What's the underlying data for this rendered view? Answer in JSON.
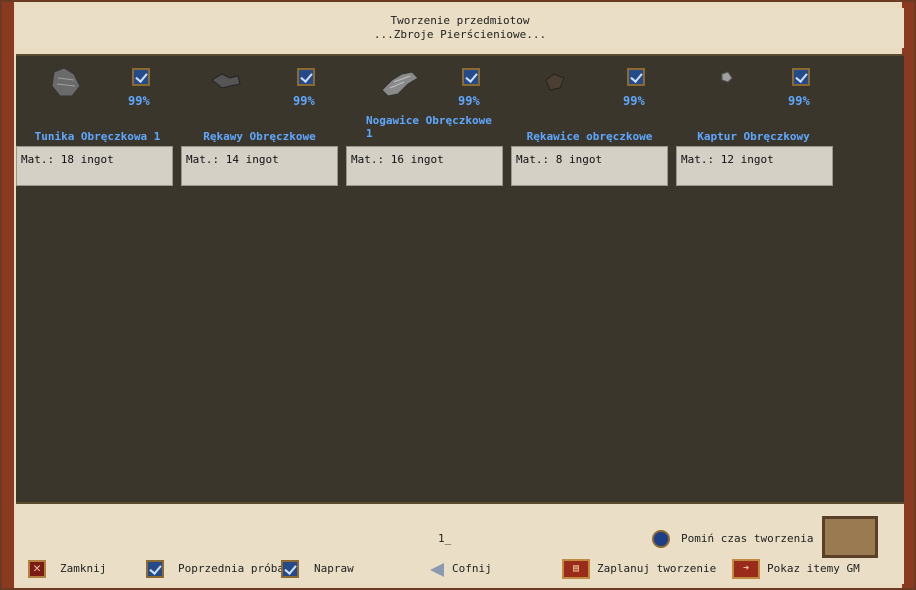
{
  "header": {
    "title": "Tworzenie przedmiotow",
    "subtitle": "...Zbroje Pierścieniowe..."
  },
  "items": [
    {
      "name": "Tunika Obręczkowa 1",
      "chance": "99%",
      "materials": "Mat.: 18 ingot",
      "icon": "chest-armor-icon"
    },
    {
      "name": "Rękawy Obręczkowe",
      "chance": "99%",
      "materials": "Mat.: 14 ingot",
      "icon": "arms-armor-icon"
    },
    {
      "name": "Nogawice Obręczkowe 1",
      "chance": "99%",
      "materials": "Mat.: 16 ingot",
      "icon": "leg-armor-icon"
    },
    {
      "name": "Rękawice obręczkowe",
      "chance": "99%",
      "materials": "Mat.: 8 ingot",
      "icon": "gloves-icon"
    },
    {
      "name": "Kaptur Obręczkowy",
      "chance": "99%",
      "materials": "Mat.: 12 ingot",
      "icon": "helmet-icon"
    }
  ],
  "footer": {
    "amount": "1_",
    "skip_time": "Pomiń czas tworzenia",
    "close": "Zamknij",
    "previous_attempt": "Poprzednia próba",
    "repair": "Napraw",
    "back": "Cofnij",
    "plan": "Zaplanuj tworzenie",
    "show_gm": "Pokaz itemy GM"
  },
  "colors": {
    "accent": "#5fa8ff",
    "panel": "#3b362b",
    "parchment": "#eadfc6"
  }
}
